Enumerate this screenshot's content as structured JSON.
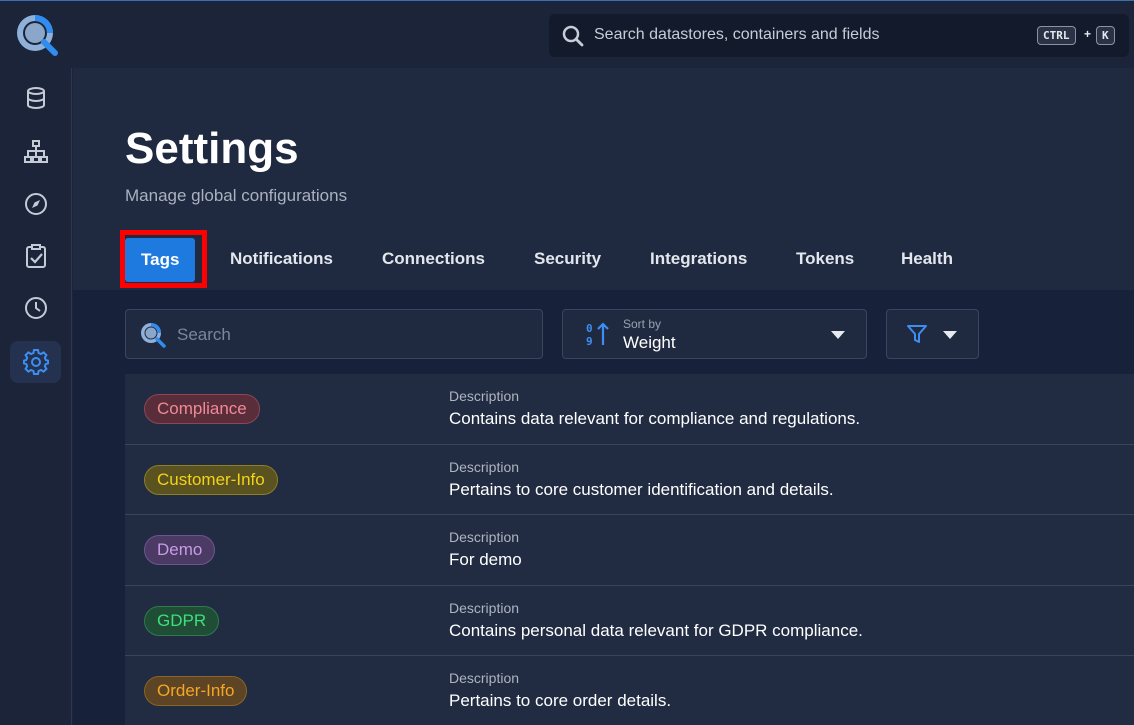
{
  "header": {
    "search_placeholder": "Search datastores, containers and fields",
    "shortcut_ctrl": "CTRL",
    "shortcut_plus": "+",
    "shortcut_key": "K"
  },
  "sidebar": {
    "items": [
      {
        "icon": "database-icon",
        "active": false
      },
      {
        "icon": "hierarchy-icon",
        "active": false
      },
      {
        "icon": "compass-icon",
        "active": false
      },
      {
        "icon": "clipboard-check-icon",
        "active": false
      },
      {
        "icon": "clock-icon",
        "active": false
      },
      {
        "icon": "gear-icon",
        "active": true
      }
    ]
  },
  "page": {
    "title": "Settings",
    "subtitle": "Manage global configurations"
  },
  "tabs": [
    "Tags",
    "Notifications",
    "Connections",
    "Security",
    "Integrations",
    "Tokens",
    "Health"
  ],
  "active_tab": "Tags",
  "filters": {
    "search_placeholder": "Search",
    "sort_label": "Sort by",
    "sort_value": "Weight"
  },
  "tags": [
    {
      "name": "Compliance",
      "description_label": "Description",
      "description": "Contains data relevant for compliance and regulations.",
      "color": "#f08a96",
      "bg": "#5a2d3a",
      "border": "#8f4553"
    },
    {
      "name": "Customer-Info",
      "description_label": "Description",
      "description": "Pertains to core customer identification and details.",
      "color": "#f2d21b",
      "bg": "#5a5320",
      "border": "#8c7f25"
    },
    {
      "name": "Demo",
      "description_label": "Description",
      "description": "For demo",
      "color": "#c89ae8",
      "bg": "#4b3a64",
      "border": "#6e5590"
    },
    {
      "name": "GDPR",
      "description_label": "Description",
      "description": "Contains personal data relevant for GDPR compliance.",
      "color": "#3ee07a",
      "bg": "#1f4d36",
      "border": "#2f7a4e"
    },
    {
      "name": "Order-Info",
      "description_label": "Description",
      "description": "Pertains to core order details.",
      "color": "#f5a623",
      "bg": "#5c4425",
      "border": "#8c6424"
    }
  ],
  "colors": {
    "accent": "#1f7ae0",
    "highlight": "#ff0000"
  }
}
